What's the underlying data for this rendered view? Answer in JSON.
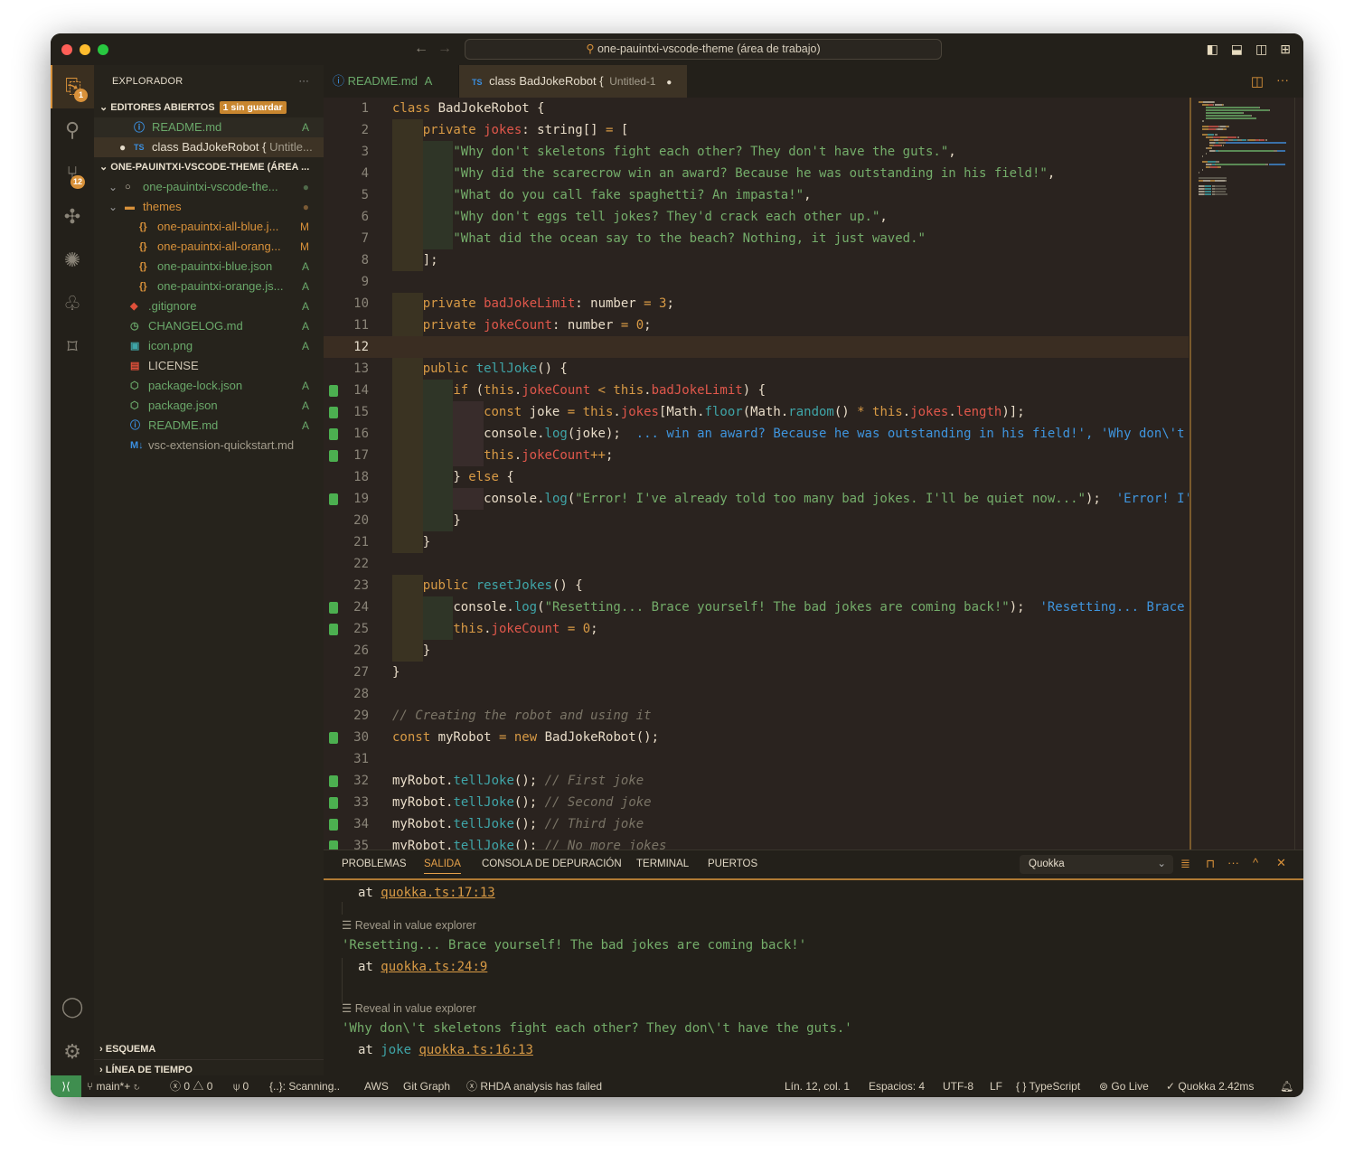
{
  "window": {
    "search": "one-pauintxi-vscode-theme (área de trabajo)"
  },
  "activity": {
    "explorer_badge": "1",
    "scm_badge": "12"
  },
  "sidebar": {
    "title": "EXPLORADOR",
    "more": "···",
    "open_editors": {
      "label": "EDITORES ABIERTOS",
      "badge": "1 sin guardar",
      "items": [
        {
          "name": "README.md",
          "status": "A"
        },
        {
          "name": "class BadJokeRobot {",
          "desc": "Untitle..."
        }
      ]
    },
    "workspace": {
      "label": "ONE-PAUINTXI-VSCODE-THEME (ÁREA ...",
      "items": [
        {
          "name": "one-pauintxi-vscode-the...",
          "status": "●",
          "icon": "repo-icon",
          "level": 1,
          "color": "#6aa86a",
          "scolor": "#4f6a4a"
        },
        {
          "name": "themes",
          "status": "●",
          "icon": "folder-icon",
          "level": 1,
          "color": "#d8913a",
          "scolor": "#7a5a35"
        },
        {
          "name": "one-pauintxi-all-blue.j...",
          "status": "M",
          "icon": "json-icon",
          "level": 2,
          "color": "#d8913a",
          "scolor": "#d8913a"
        },
        {
          "name": "one-pauintxi-all-orang...",
          "status": "M",
          "icon": "json-icon",
          "level": 2,
          "color": "#d8913a",
          "scolor": "#d8913a"
        },
        {
          "name": "one-pauintxi-blue.json",
          "status": "A",
          "icon": "json-icon",
          "level": 2,
          "color": "#6aa86a",
          "scolor": "#6aa86a"
        },
        {
          "name": "one-pauintxi-orange.js...",
          "status": "A",
          "icon": "json-icon",
          "level": 2,
          "color": "#6aa86a",
          "scolor": "#6aa86a"
        },
        {
          "name": ".gitignore",
          "status": "A",
          "icon": "git-icon",
          "level": 1,
          "color": "#6aa86a",
          "scolor": "#6aa86a"
        },
        {
          "name": "CHANGELOG.md",
          "status": "A",
          "icon": "history-icon",
          "level": 1,
          "color": "#6aa86a",
          "scolor": "#6aa86a"
        },
        {
          "name": "icon.png",
          "status": "A",
          "icon": "image-icon",
          "level": 1,
          "color": "#6aa86a",
          "scolor": "#6aa86a"
        },
        {
          "name": "LICENSE",
          "status": "",
          "icon": "license-icon",
          "level": 1,
          "color": "#cfc6b4",
          "scolor": "#cfc6b4"
        },
        {
          "name": "package-lock.json",
          "status": "A",
          "icon": "nodejs-icon",
          "level": 1,
          "color": "#6aa86a",
          "scolor": "#6aa86a"
        },
        {
          "name": "package.json",
          "status": "A",
          "icon": "nodejs-icon",
          "level": 1,
          "color": "#6aa86a",
          "scolor": "#6aa86a"
        },
        {
          "name": "README.md",
          "status": "A",
          "icon": "info-icon",
          "level": 1,
          "color": "#6aa86a",
          "scolor": "#6aa86a"
        },
        {
          "name": "vsc-extension-quickstart.md",
          "status": "",
          "icon": "markdown-icon",
          "level": 1,
          "color": "#a39c8c",
          "scolor": "#a39c8c"
        }
      ]
    },
    "outline": "ESQUEMA",
    "timeline": "LÍNEA DE TIEMPO"
  },
  "tabs": [
    {
      "label": "README.md",
      "status": "A",
      "active": false
    },
    {
      "label": "class BadJokeRobot {",
      "desc": "Untitled-1",
      "dirty": "●",
      "active": true
    }
  ],
  "editor": {
    "current_line": 12,
    "lines": [
      {
        "i": 0,
        "g": 0,
        "t": [
          [
            "k",
            "class "
          ],
          [
            "t",
            "BadJokeRobot "
          ],
          [
            "p",
            "{"
          ]
        ]
      },
      {
        "i": 1,
        "g": 0,
        "t": [
          [
            "k",
            "private "
          ],
          [
            "r",
            "jokes"
          ],
          [
            "p",
            ": "
          ],
          [
            "t",
            "string[] "
          ],
          [
            "k",
            "= "
          ],
          [
            "p",
            "["
          ]
        ]
      },
      {
        "i": 2,
        "g": 0,
        "t": [
          [
            "s",
            "\"Why don't skeletons fight each other? They don't have the guts.\""
          ],
          [
            "p",
            ","
          ]
        ]
      },
      {
        "i": 2,
        "g": 0,
        "t": [
          [
            "s",
            "\"Why did the scarecrow win an award? Because he was outstanding in his field!\""
          ],
          [
            "p",
            ","
          ]
        ]
      },
      {
        "i": 2,
        "g": 0,
        "t": [
          [
            "s",
            "\"What do you call fake spaghetti? An impasta!\""
          ],
          [
            "p",
            ","
          ]
        ]
      },
      {
        "i": 2,
        "g": 0,
        "t": [
          [
            "s",
            "\"Why don't eggs tell jokes? They'd crack each other up.\""
          ],
          [
            "p",
            ","
          ]
        ]
      },
      {
        "i": 2,
        "g": 0,
        "t": [
          [
            "s",
            "\"What did the ocean say to the beach? Nothing, it just waved.\""
          ]
        ]
      },
      {
        "i": 1,
        "g": 0,
        "t": [
          [
            "p",
            "];"
          ]
        ]
      },
      {
        "i": 0,
        "g": 0,
        "t": []
      },
      {
        "i": 1,
        "g": 0,
        "t": [
          [
            "k",
            "private "
          ],
          [
            "r",
            "badJokeLimit"
          ],
          [
            "p",
            ": "
          ],
          [
            "t",
            "number "
          ],
          [
            "k",
            "= "
          ],
          [
            "n",
            "3"
          ],
          [
            "p",
            ";"
          ]
        ]
      },
      {
        "i": 1,
        "g": 0,
        "t": [
          [
            "k",
            "private "
          ],
          [
            "r",
            "jokeCount"
          ],
          [
            "p",
            ": "
          ],
          [
            "t",
            "number "
          ],
          [
            "k",
            "= "
          ],
          [
            "n",
            "0"
          ],
          [
            "p",
            ";"
          ]
        ]
      },
      {
        "i": 0,
        "g": 0,
        "t": []
      },
      {
        "i": 1,
        "g": 0,
        "t": [
          [
            "k",
            "public "
          ],
          [
            "f",
            "tellJoke"
          ],
          [
            "p",
            "() {"
          ]
        ]
      },
      {
        "i": 2,
        "g": 1,
        "t": [
          [
            "k",
            "if "
          ],
          [
            "p",
            "("
          ],
          [
            "k",
            "this"
          ],
          [
            "p",
            "."
          ],
          [
            "r",
            "jokeCount"
          ],
          [
            "k",
            " < "
          ],
          [
            "k",
            "this"
          ],
          [
            "p",
            "."
          ],
          [
            "r",
            "badJokeLimit"
          ],
          [
            "p",
            ") {"
          ]
        ]
      },
      {
        "i": 3,
        "g": 1,
        "t": [
          [
            "k",
            "const "
          ],
          [
            "t",
            "joke "
          ],
          [
            "k",
            "= "
          ],
          [
            "k",
            "this"
          ],
          [
            "p",
            "."
          ],
          [
            "r",
            "jokes"
          ],
          [
            "p",
            "[Math."
          ],
          [
            "f",
            "floor"
          ],
          [
            "p",
            "(Math."
          ],
          [
            "f",
            "random"
          ],
          [
            "p",
            "() "
          ],
          [
            "k",
            "* "
          ],
          [
            "k",
            "this"
          ],
          [
            "p",
            "."
          ],
          [
            "r",
            "jokes"
          ],
          [
            "p",
            "."
          ],
          [
            "r",
            "length"
          ],
          [
            "p",
            ")];"
          ]
        ]
      },
      {
        "i": 3,
        "g": 1,
        "t": [
          [
            "t",
            "console"
          ],
          [
            "p",
            "."
          ],
          [
            "f",
            "log"
          ],
          [
            "p",
            "(joke);  "
          ],
          [
            "v",
            "... win an award? Because he was outstanding in his field!', 'Why don\\'t s"
          ]
        ]
      },
      {
        "i": 3,
        "g": 1,
        "t": [
          [
            "k",
            "this"
          ],
          [
            "p",
            "."
          ],
          [
            "r",
            "jokeCount"
          ],
          [
            "k",
            "++"
          ],
          [
            "p",
            ";"
          ]
        ]
      },
      {
        "i": 2,
        "g": 0,
        "t": [
          [
            "p",
            "} "
          ],
          [
            "k",
            "else "
          ],
          [
            "p",
            "{"
          ]
        ]
      },
      {
        "i": 3,
        "g": 1,
        "t": [
          [
            "t",
            "console"
          ],
          [
            "p",
            "."
          ],
          [
            "f",
            "log"
          ],
          [
            "p",
            "("
          ],
          [
            "s",
            "\"Error! I've already told too many bad jokes. I'll be quiet now...\""
          ],
          [
            "p",
            ");  "
          ],
          [
            "v",
            "'Error! I'"
          ]
        ]
      },
      {
        "i": 2,
        "g": 0,
        "t": [
          [
            "p",
            "}"
          ]
        ]
      },
      {
        "i": 1,
        "g": 0,
        "t": [
          [
            "p",
            "}"
          ]
        ]
      },
      {
        "i": 0,
        "g": 0,
        "t": []
      },
      {
        "i": 1,
        "g": 0,
        "t": [
          [
            "k",
            "public "
          ],
          [
            "f",
            "resetJokes"
          ],
          [
            "p",
            "() {"
          ]
        ]
      },
      {
        "i": 2,
        "g": 1,
        "t": [
          [
            "t",
            "console"
          ],
          [
            "p",
            "."
          ],
          [
            "f",
            "log"
          ],
          [
            "p",
            "("
          ],
          [
            "s",
            "\"Resetting... Brace yourself! The bad jokes are coming back!\""
          ],
          [
            "p",
            ");  "
          ],
          [
            "v",
            "'Resetting... Brace "
          ]
        ]
      },
      {
        "i": 2,
        "g": 1,
        "t": [
          [
            "k",
            "this"
          ],
          [
            "p",
            "."
          ],
          [
            "r",
            "jokeCount"
          ],
          [
            "k",
            " = "
          ],
          [
            "n",
            "0"
          ],
          [
            "p",
            ";"
          ]
        ]
      },
      {
        "i": 1,
        "g": 0,
        "t": [
          [
            "p",
            "}"
          ]
        ]
      },
      {
        "i": 0,
        "g": 0,
        "t": [
          [
            "p",
            "}"
          ]
        ]
      },
      {
        "i": 0,
        "g": 0,
        "t": []
      },
      {
        "i": 0,
        "g": 0,
        "t": [
          [
            "c",
            "// Creating the robot and using it"
          ]
        ]
      },
      {
        "i": 0,
        "g": 1,
        "t": [
          [
            "k",
            "const "
          ],
          [
            "t",
            "myRobot "
          ],
          [
            "k",
            "= new "
          ],
          [
            "t",
            "BadJokeRobot"
          ],
          [
            "p",
            "();"
          ]
        ]
      },
      {
        "i": 0,
        "g": 0,
        "t": []
      },
      {
        "i": 0,
        "g": 1,
        "t": [
          [
            "t",
            "myRobot"
          ],
          [
            "p",
            "."
          ],
          [
            "f",
            "tellJoke"
          ],
          [
            "p",
            "(); "
          ],
          [
            "c",
            "// First joke"
          ]
        ]
      },
      {
        "i": 0,
        "g": 1,
        "t": [
          [
            "t",
            "myRobot"
          ],
          [
            "p",
            "."
          ],
          [
            "f",
            "tellJoke"
          ],
          [
            "p",
            "(); "
          ],
          [
            "c",
            "// Second joke"
          ]
        ]
      },
      {
        "i": 0,
        "g": 1,
        "t": [
          [
            "t",
            "myRobot"
          ],
          [
            "p",
            "."
          ],
          [
            "f",
            "tellJoke"
          ],
          [
            "p",
            "(); "
          ],
          [
            "c",
            "// Third joke"
          ]
        ]
      },
      {
        "i": 0,
        "g": 1,
        "t": [
          [
            "t",
            "myRobot"
          ],
          [
            "p",
            "."
          ],
          [
            "f",
            "tellJoke"
          ],
          [
            "p",
            "(); "
          ],
          [
            "c",
            "// No more jokes"
          ]
        ]
      }
    ]
  },
  "panel": {
    "tabs": [
      "PROBLEMAS",
      "SALIDA",
      "CONSOLA DE DEPURACIÓN",
      "TERMINAL",
      "PUERTOS"
    ],
    "active_tab": "SALIDA",
    "channel": "Quokka",
    "out": {
      "at0": "at ",
      "loc0": "quokka.ts:17:13",
      "reveal1": "Reveal in value explorer",
      "val1": "'Resetting... Brace yourself! The bad jokes are coming back!'",
      "at1": "at ",
      "loc1": "quokka.ts:24:9",
      "reveal2": "Reveal in value explorer",
      "val2": "'Why don\\'t skeletons fight each other? They don\\'t have the guts.'",
      "at2": "at ",
      "var2": "joke ",
      "loc2": "quokka.ts:16:13"
    }
  },
  "status": {
    "branch": "main*+",
    "errors": "0",
    "warnings": "0",
    "ports": "0",
    "scanning": "{..}: Scanning..",
    "aws": "AWS",
    "gitgraph": "Git Graph",
    "rhda": "RHDA analysis has failed",
    "position": "Lín. 12, col. 1",
    "spaces": "Espacios: 4",
    "encoding": "UTF-8",
    "eol": "LF",
    "language": "TypeScript",
    "golive": "Go Live",
    "quokka": "Quokka 2.42ms"
  }
}
